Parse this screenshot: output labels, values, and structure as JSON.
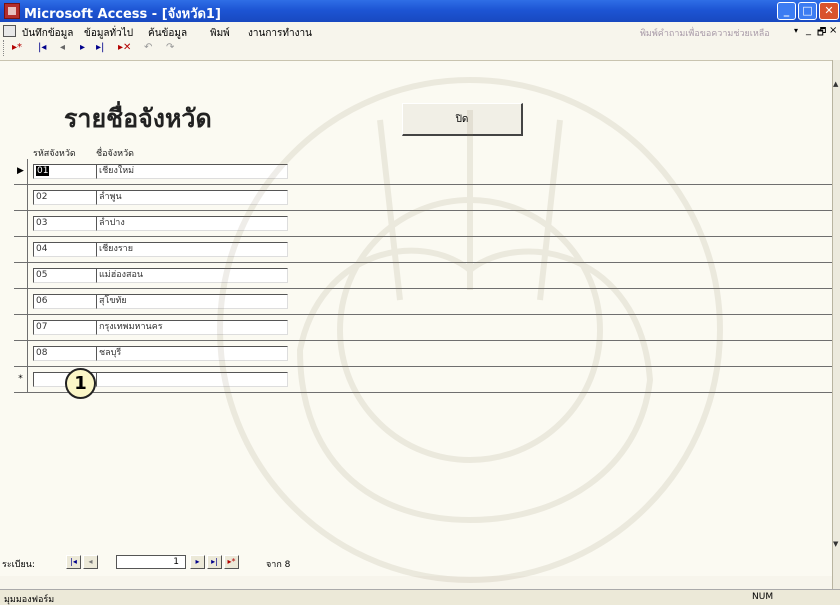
{
  "window": {
    "title": "Microsoft Access - [จังหวัด1]"
  },
  "caption_buttons": {
    "minimize": "_",
    "maximize": "□",
    "close": "✕"
  },
  "menu": {
    "items": [
      "บันทึกข้อมูล",
      "ข้อมูลทั่วไป",
      "ค้นข้อมูล",
      "พิมพ์",
      "งานการทำงาน"
    ],
    "help_placeholder": "พิมพ์คำถามเพื่อขอความช่วยเหลือ",
    "help_arrow": "▾",
    "mdi": {
      "min": "_",
      "restore": "🗗",
      "close": "×"
    }
  },
  "toolbar": {
    "icons": [
      "▸*",
      "|◂",
      "◂",
      "▸",
      "▸|",
      "▸✕",
      "↶",
      "↷"
    ]
  },
  "form": {
    "title": "รายชื่อจังหวัด",
    "close_button_label": "ปิด",
    "columns": {
      "code": "รหัสจังหวัด",
      "name": "ชื่อจังหวัด"
    },
    "records": [
      {
        "code": "01",
        "name": "เชียงใหม่",
        "selector": "▶"
      },
      {
        "code": "02",
        "name": "ลำพูน",
        "selector": ""
      },
      {
        "code": "03",
        "name": "ลำปาง",
        "selector": ""
      },
      {
        "code": "04",
        "name": "เชียงราย",
        "selector": ""
      },
      {
        "code": "05",
        "name": "แม่ฮ่องสอน",
        "selector": ""
      },
      {
        "code": "06",
        "name": "สุโขทัย",
        "selector": ""
      },
      {
        "code": "07",
        "name": "กรุงเทพมหานคร",
        "selector": ""
      },
      {
        "code": "08",
        "name": "ชลบุรี",
        "selector": ""
      }
    ],
    "new_record_selector": "*",
    "callout": "1"
  },
  "record_nav": {
    "label": "ระเบียน:",
    "first": "|◂",
    "prev": "◂",
    "current": "1",
    "next": "▸",
    "last": "▸|",
    "new": "▸*",
    "of_text": "จาก 8"
  },
  "status": {
    "text": "มุมมองฟอร์ม",
    "num": "NUM"
  },
  "colors": {
    "title_bar": "#1d55d4",
    "form_background": "#fbfaf2",
    "callout_fill": "#fbf6c7"
  }
}
